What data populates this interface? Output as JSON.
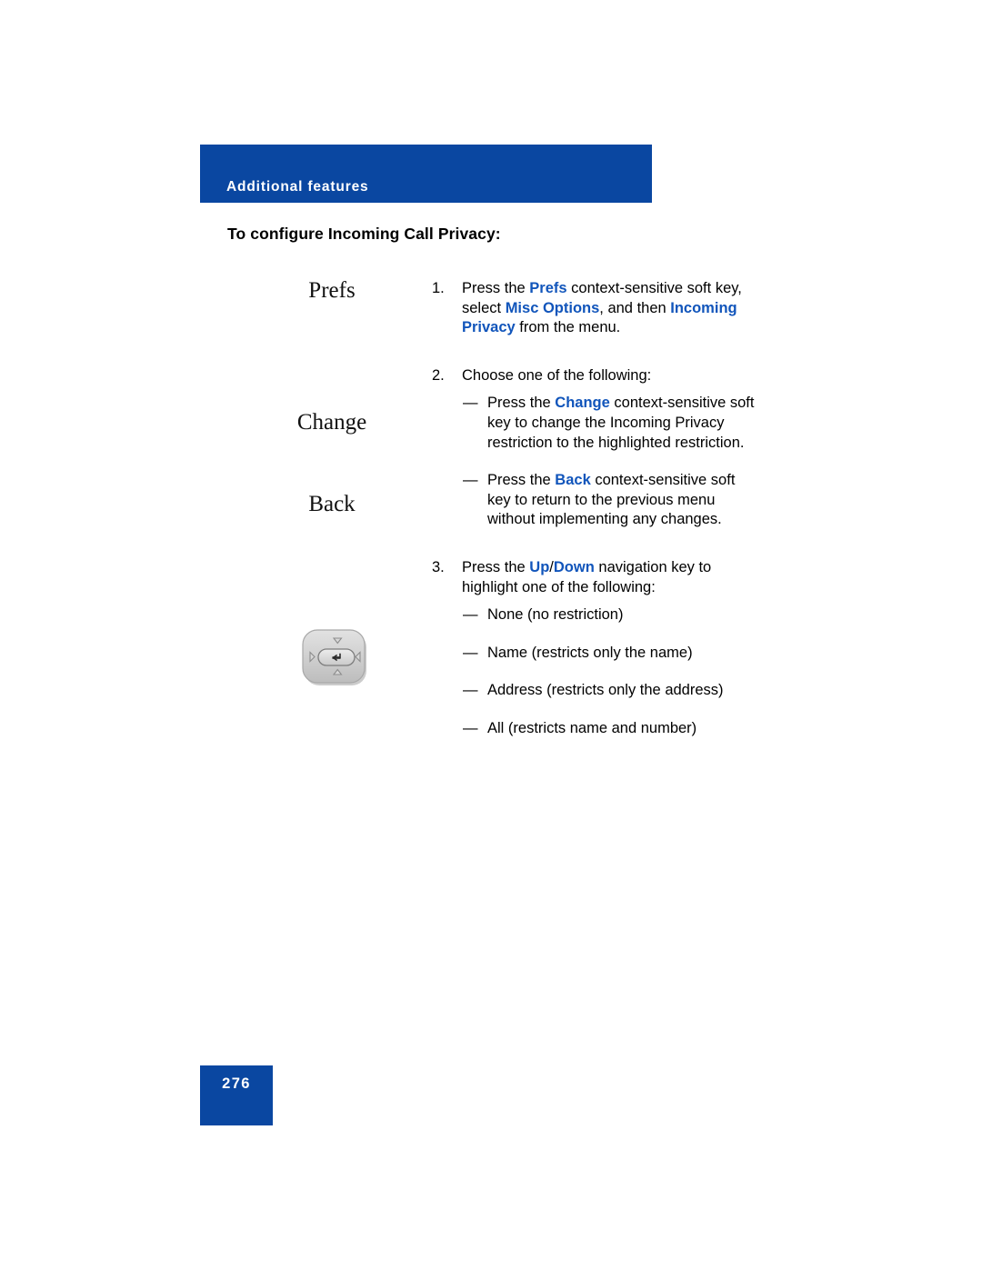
{
  "header": {
    "chapter_label": "Additional features"
  },
  "section": {
    "title": "To configure Incoming Call Privacy:"
  },
  "margin_labels": {
    "prefs": "Prefs",
    "change": "Change",
    "back": "Back",
    "navigation_key_icon": "navigation-key-icon"
  },
  "steps": [
    {
      "number": "1.",
      "parts": [
        {
          "text": "Press the ",
          "style": "normal"
        },
        {
          "text": "Prefs",
          "style": "bold-blue"
        },
        {
          "text": " context-sensitive soft key, select ",
          "style": "normal"
        },
        {
          "text": "Misc Options",
          "style": "bold-blue"
        },
        {
          "text": ", and then ",
          "style": "normal"
        },
        {
          "text": "Incoming Privacy",
          "style": "bold-blue"
        },
        {
          "text": " from the menu.",
          "style": "normal"
        }
      ],
      "sub_items": []
    },
    {
      "number": "2.",
      "parts": [
        {
          "text": "Choose one of the following:",
          "style": "normal"
        }
      ],
      "sub_items": [
        {
          "dash": "—",
          "parts": [
            {
              "text": "Press the ",
              "style": "normal"
            },
            {
              "text": "Change",
              "style": "bold-blue"
            },
            {
              "text": " context-sensitive soft key to change the Incoming Privacy restriction to the highlighted restriction.",
              "style": "normal"
            }
          ]
        },
        {
          "dash": "—",
          "parts": [
            {
              "text": "Press the ",
              "style": "normal"
            },
            {
              "text": "Back",
              "style": "bold-blue"
            },
            {
              "text": " context-sensitive soft key to return to the previous menu without implementing any changes.",
              "style": "normal"
            }
          ]
        }
      ]
    },
    {
      "number": "3.",
      "parts": [
        {
          "text": "Press the ",
          "style": "normal"
        },
        {
          "text": "Up",
          "style": "bold-blue"
        },
        {
          "text": "/",
          "style": "normal"
        },
        {
          "text": "Down",
          "style": "bold-blue"
        },
        {
          "text": " navigation key to highlight one of the following:",
          "style": "normal"
        }
      ],
      "sub_items": [
        {
          "dash": "—",
          "parts": [
            {
              "text": "None (no restriction)",
              "style": "normal"
            }
          ]
        },
        {
          "dash": "—",
          "parts": [
            {
              "text": "Name (restricts only the name)",
              "style": "normal"
            }
          ]
        },
        {
          "dash": "—",
          "parts": [
            {
              "text": "Address (restricts only the address)",
              "style": "normal"
            }
          ]
        },
        {
          "dash": "—",
          "parts": [
            {
              "text": "All (restricts name and number)",
              "style": "normal"
            }
          ]
        }
      ]
    }
  ],
  "footer": {
    "page_number": "276"
  },
  "colors": {
    "banner_blue": "#0a47a1",
    "link_blue": "#1155bb",
    "body_text": "#000000",
    "page_background": "#ffffff"
  }
}
